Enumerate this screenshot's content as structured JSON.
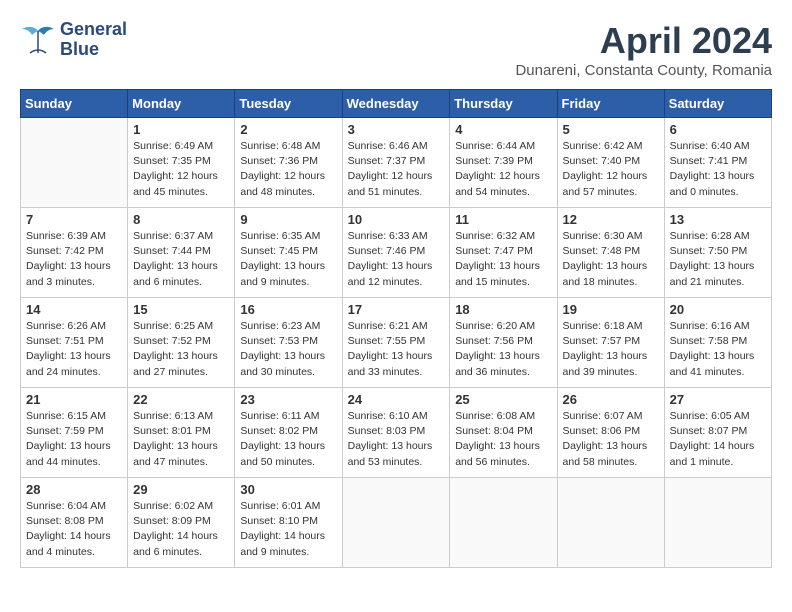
{
  "header": {
    "logo_line1": "General",
    "logo_line2": "Blue",
    "month": "April 2024",
    "location": "Dunareni, Constanta County, Romania"
  },
  "weekdays": [
    "Sunday",
    "Monday",
    "Tuesday",
    "Wednesday",
    "Thursday",
    "Friday",
    "Saturday"
  ],
  "weeks": [
    [
      {
        "day": "",
        "info": ""
      },
      {
        "day": "1",
        "info": "Sunrise: 6:49 AM\nSunset: 7:35 PM\nDaylight: 12 hours\nand 45 minutes."
      },
      {
        "day": "2",
        "info": "Sunrise: 6:48 AM\nSunset: 7:36 PM\nDaylight: 12 hours\nand 48 minutes."
      },
      {
        "day": "3",
        "info": "Sunrise: 6:46 AM\nSunset: 7:37 PM\nDaylight: 12 hours\nand 51 minutes."
      },
      {
        "day": "4",
        "info": "Sunrise: 6:44 AM\nSunset: 7:39 PM\nDaylight: 12 hours\nand 54 minutes."
      },
      {
        "day": "5",
        "info": "Sunrise: 6:42 AM\nSunset: 7:40 PM\nDaylight: 12 hours\nand 57 minutes."
      },
      {
        "day": "6",
        "info": "Sunrise: 6:40 AM\nSunset: 7:41 PM\nDaylight: 13 hours\nand 0 minutes."
      }
    ],
    [
      {
        "day": "7",
        "info": "Sunrise: 6:39 AM\nSunset: 7:42 PM\nDaylight: 13 hours\nand 3 minutes."
      },
      {
        "day": "8",
        "info": "Sunrise: 6:37 AM\nSunset: 7:44 PM\nDaylight: 13 hours\nand 6 minutes."
      },
      {
        "day": "9",
        "info": "Sunrise: 6:35 AM\nSunset: 7:45 PM\nDaylight: 13 hours\nand 9 minutes."
      },
      {
        "day": "10",
        "info": "Sunrise: 6:33 AM\nSunset: 7:46 PM\nDaylight: 13 hours\nand 12 minutes."
      },
      {
        "day": "11",
        "info": "Sunrise: 6:32 AM\nSunset: 7:47 PM\nDaylight: 13 hours\nand 15 minutes."
      },
      {
        "day": "12",
        "info": "Sunrise: 6:30 AM\nSunset: 7:48 PM\nDaylight: 13 hours\nand 18 minutes."
      },
      {
        "day": "13",
        "info": "Sunrise: 6:28 AM\nSunset: 7:50 PM\nDaylight: 13 hours\nand 21 minutes."
      }
    ],
    [
      {
        "day": "14",
        "info": "Sunrise: 6:26 AM\nSunset: 7:51 PM\nDaylight: 13 hours\nand 24 minutes."
      },
      {
        "day": "15",
        "info": "Sunrise: 6:25 AM\nSunset: 7:52 PM\nDaylight: 13 hours\nand 27 minutes."
      },
      {
        "day": "16",
        "info": "Sunrise: 6:23 AM\nSunset: 7:53 PM\nDaylight: 13 hours\nand 30 minutes."
      },
      {
        "day": "17",
        "info": "Sunrise: 6:21 AM\nSunset: 7:55 PM\nDaylight: 13 hours\nand 33 minutes."
      },
      {
        "day": "18",
        "info": "Sunrise: 6:20 AM\nSunset: 7:56 PM\nDaylight: 13 hours\nand 36 minutes."
      },
      {
        "day": "19",
        "info": "Sunrise: 6:18 AM\nSunset: 7:57 PM\nDaylight: 13 hours\nand 39 minutes."
      },
      {
        "day": "20",
        "info": "Sunrise: 6:16 AM\nSunset: 7:58 PM\nDaylight: 13 hours\nand 41 minutes."
      }
    ],
    [
      {
        "day": "21",
        "info": "Sunrise: 6:15 AM\nSunset: 7:59 PM\nDaylight: 13 hours\nand 44 minutes."
      },
      {
        "day": "22",
        "info": "Sunrise: 6:13 AM\nSunset: 8:01 PM\nDaylight: 13 hours\nand 47 minutes."
      },
      {
        "day": "23",
        "info": "Sunrise: 6:11 AM\nSunset: 8:02 PM\nDaylight: 13 hours\nand 50 minutes."
      },
      {
        "day": "24",
        "info": "Sunrise: 6:10 AM\nSunset: 8:03 PM\nDaylight: 13 hours\nand 53 minutes."
      },
      {
        "day": "25",
        "info": "Sunrise: 6:08 AM\nSunset: 8:04 PM\nDaylight: 13 hours\nand 56 minutes."
      },
      {
        "day": "26",
        "info": "Sunrise: 6:07 AM\nSunset: 8:06 PM\nDaylight: 13 hours\nand 58 minutes."
      },
      {
        "day": "27",
        "info": "Sunrise: 6:05 AM\nSunset: 8:07 PM\nDaylight: 14 hours\nand 1 minute."
      }
    ],
    [
      {
        "day": "28",
        "info": "Sunrise: 6:04 AM\nSunset: 8:08 PM\nDaylight: 14 hours\nand 4 minutes."
      },
      {
        "day": "29",
        "info": "Sunrise: 6:02 AM\nSunset: 8:09 PM\nDaylight: 14 hours\nand 6 minutes."
      },
      {
        "day": "30",
        "info": "Sunrise: 6:01 AM\nSunset: 8:10 PM\nDaylight: 14 hours\nand 9 minutes."
      },
      {
        "day": "",
        "info": ""
      },
      {
        "day": "",
        "info": ""
      },
      {
        "day": "",
        "info": ""
      },
      {
        "day": "",
        "info": ""
      }
    ]
  ]
}
